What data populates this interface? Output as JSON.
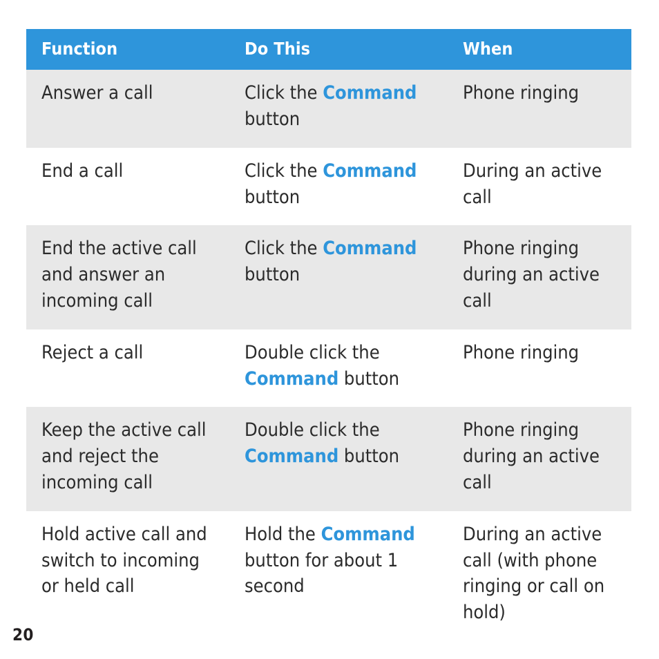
{
  "colors": {
    "header_bg": "#2e95db",
    "header_text": "#ffffff",
    "row_shaded_bg": "#e8e8e8",
    "row_plain_bg": "#ffffff",
    "body_text": "#2b2b2b",
    "command_accent": "#2e95db",
    "page_number_text": "#231f20"
  },
  "table": {
    "columns": [
      {
        "label": "Function"
      },
      {
        "label": "Do This"
      },
      {
        "label": "When"
      }
    ],
    "rows": [
      {
        "shaded": true,
        "function": "Answer a call",
        "do_this": {
          "prefix": "Click the ",
          "command": "Command",
          "suffix": " button"
        },
        "when": "Phone ringing"
      },
      {
        "shaded": false,
        "function": "End a call",
        "do_this": {
          "prefix": "Click the ",
          "command": "Command",
          "suffix": " button"
        },
        "when": "During an active call"
      },
      {
        "shaded": true,
        "function": "End the active call and answer an incoming call",
        "do_this": {
          "prefix": "Click the ",
          "command": "Command",
          "suffix": " button"
        },
        "when": "Phone ringing during an active call"
      },
      {
        "shaded": false,
        "function": "Reject a call",
        "do_this": {
          "prefix": "Double click the ",
          "command": "Command",
          "suffix": " button"
        },
        "when": "Phone ringing"
      },
      {
        "shaded": true,
        "function": "Keep the active call and reject the incoming call",
        "do_this": {
          "prefix": "Double click the ",
          "command": "Command",
          "suffix": " button"
        },
        "when": "Phone ringing during an active call"
      },
      {
        "shaded": false,
        "function": "Hold active call and switch to incoming or held call",
        "do_this": {
          "prefix": "Hold the ",
          "command": "Command",
          "suffix": " button for about 1 second"
        },
        "when": "During an active call (with phone ringing or call on hold)"
      }
    ]
  },
  "footer": {
    "page_number": "20"
  }
}
